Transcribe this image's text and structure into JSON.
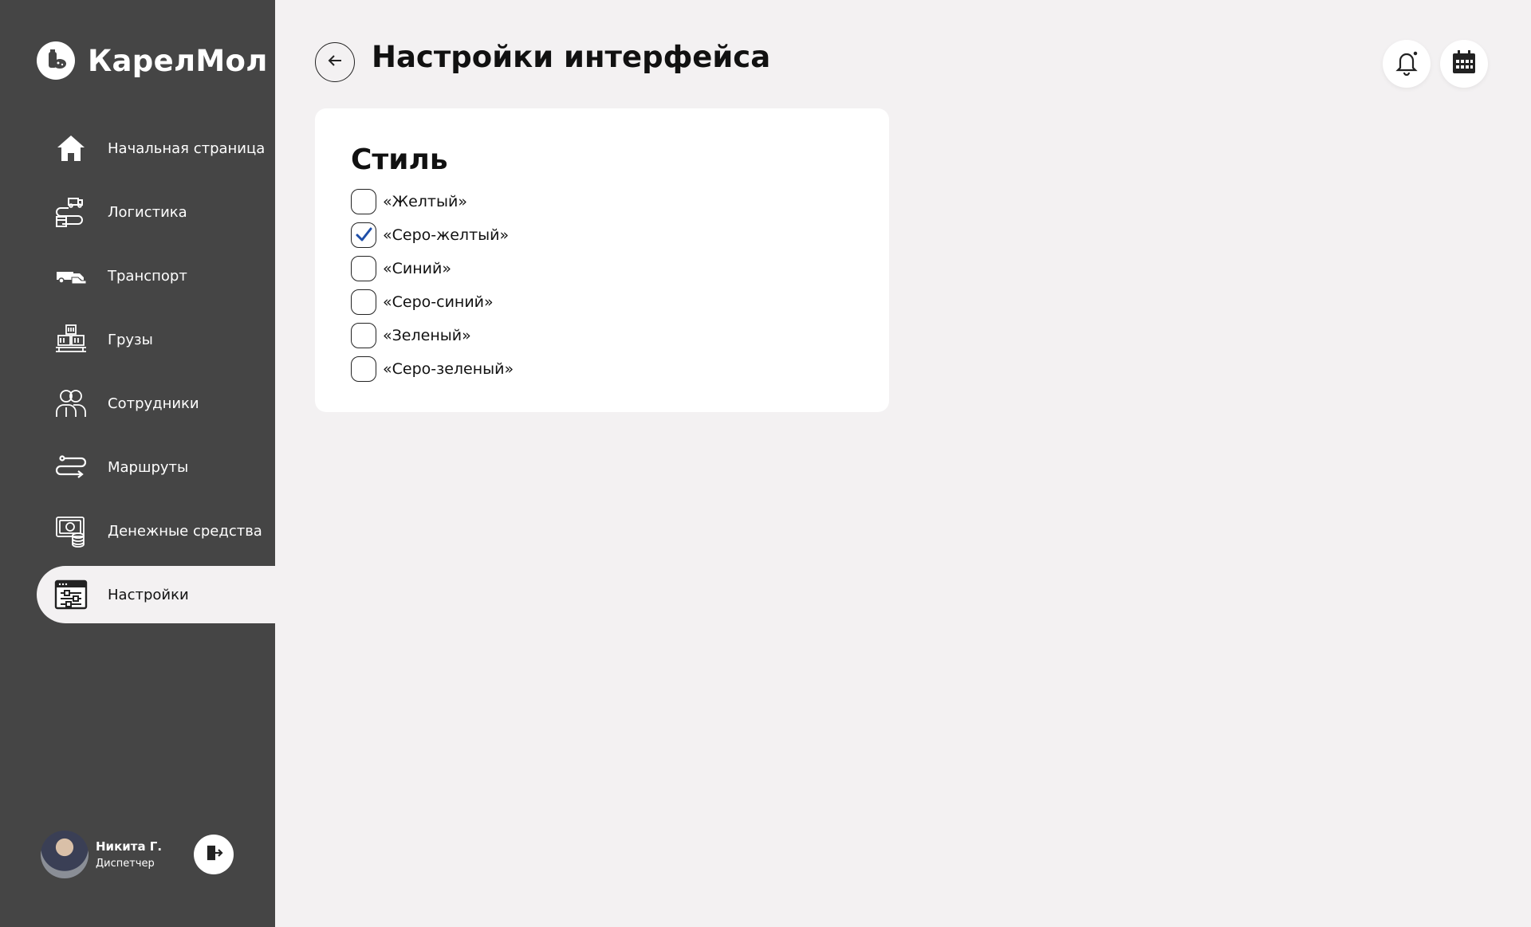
{
  "brand": {
    "name": "КарелМол"
  },
  "header": {
    "title": "Настройки интерфейса"
  },
  "sidebar": {
    "items": [
      {
        "label": "Начальная страница",
        "icon": "home-icon"
      },
      {
        "label": "Логистика",
        "icon": "logistics-icon"
      },
      {
        "label": "Транспорт",
        "icon": "transport-icon"
      },
      {
        "label": "Грузы",
        "icon": "cargo-icon"
      },
      {
        "label": "Сотрудники",
        "icon": "employees-icon"
      },
      {
        "label": "Маршруты",
        "icon": "routes-icon"
      },
      {
        "label": "Денежные средства",
        "icon": "money-icon"
      },
      {
        "label": "Настройки",
        "icon": "settings-icon",
        "active": true
      }
    ]
  },
  "user": {
    "name": "Никита Г.",
    "role": "Диспетчер"
  },
  "style_card": {
    "title": "Стиль",
    "options": [
      {
        "label": "«Желтый»",
        "checked": false
      },
      {
        "label": "«Серо-желтый»",
        "checked": true
      },
      {
        "label": "«Синий»",
        "checked": false
      },
      {
        "label": "«Серо-синий»",
        "checked": false
      },
      {
        "label": "«Зеленый»",
        "checked": false
      },
      {
        "label": "«Серо-зеленый»",
        "checked": false
      }
    ]
  },
  "colors": {
    "sidebar_bg": "#454545",
    "page_bg": "#f3f1f2",
    "check_color": "#1f4fa8",
    "card_bg": "#ffffff"
  }
}
